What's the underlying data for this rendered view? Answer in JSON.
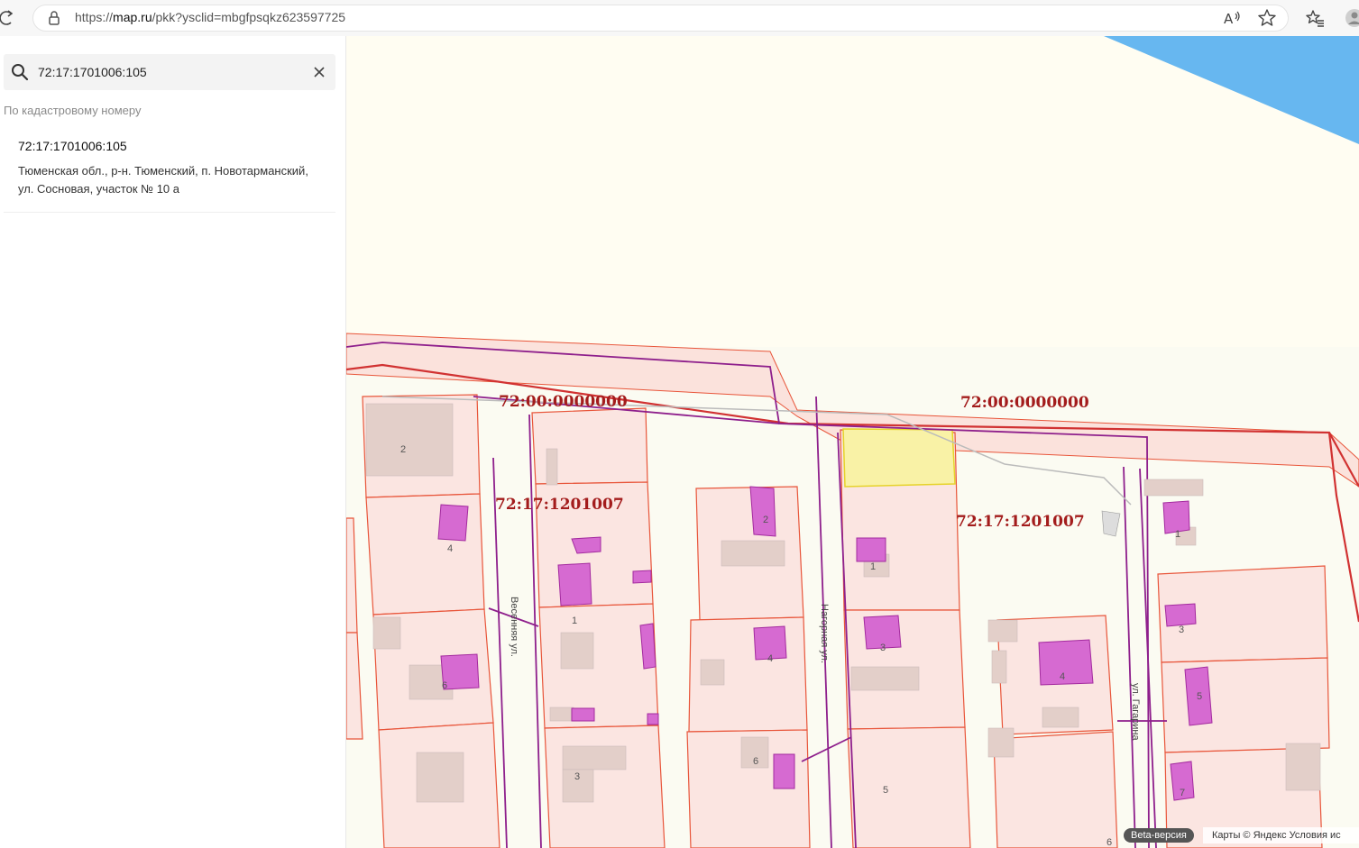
{
  "browser": {
    "url_prefix": "https://",
    "url_host": "map.ru",
    "url_path": "/pkk?ysclid=mbgfpsqkz623597725",
    "icons": [
      "reload-icon",
      "lock-icon",
      "read-aloud-icon",
      "star-icon",
      "favorites-icon",
      "profile-icon"
    ]
  },
  "search": {
    "value": "72:17:1701006:105",
    "placeholder": "",
    "section_label": "По кадастровому номеру"
  },
  "results": [
    {
      "title": "72:17:1701006:105",
      "address": "Тюменская обл., р-н. Тюменский, п. Новотарманский, ул. Сосновая, участок № 10 а"
    }
  ],
  "map": {
    "quarter_labels": [
      "72:00:0000000",
      "72:00:0000000",
      "72:17:1201007",
      "72:17:1201007"
    ],
    "streets": [
      "Весенняя ул.",
      "Нагорная ул.",
      "ул. Гагарина"
    ],
    "house_numbers": [
      "2",
      "4",
      "6",
      "1",
      "3",
      "2",
      "4",
      "6",
      "1",
      "3",
      "5",
      "4",
      "1",
      "3",
      "5",
      "7",
      "6"
    ],
    "colors": {
      "parcel_fill": "#fbe5e1",
      "parcel_stroke": "#e8553a",
      "boundary": "#d13232",
      "building_fill": "#d66ad1",
      "building_stroke": "#a32a9e",
      "selected_parcel": "#f9f2a6",
      "water": "#67b7f0",
      "utility_line": "#8e1f8c"
    }
  },
  "footer": {
    "beta": "Beta-версия",
    "attribution": "Карты © Яндекс  Условия ис"
  }
}
